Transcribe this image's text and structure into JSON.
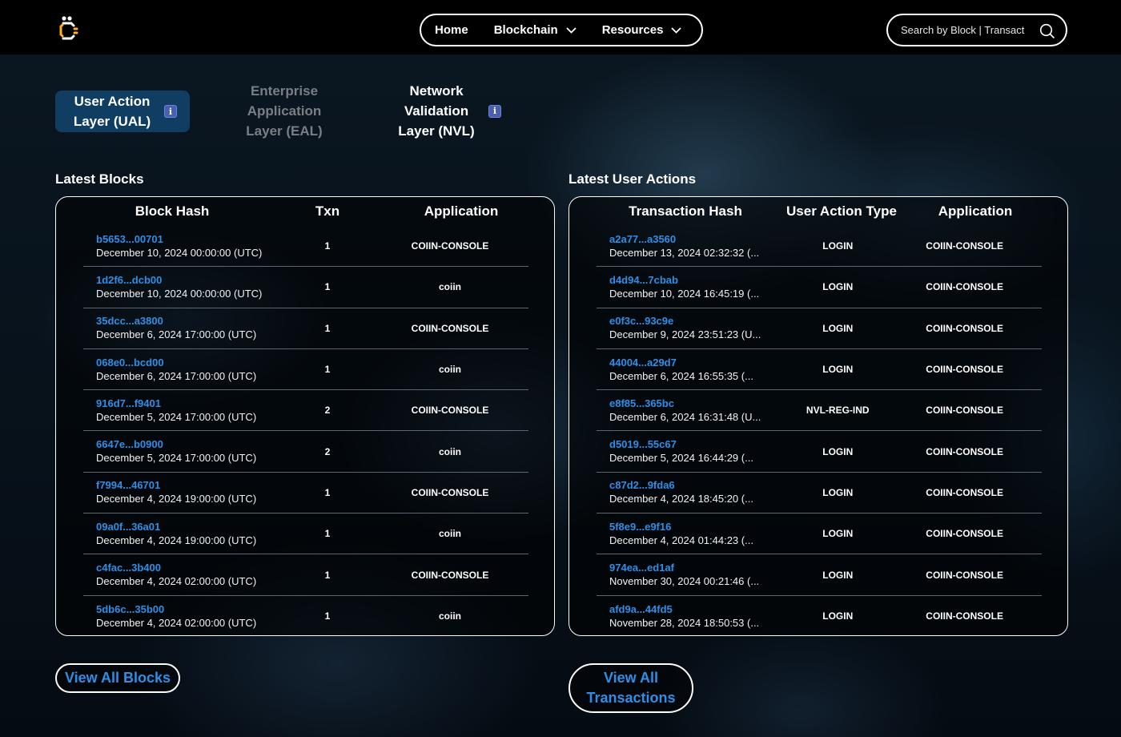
{
  "nav": {
    "home": "Home",
    "blockchain": "Blockchain",
    "resources": "Resources"
  },
  "search": {
    "placeholder": "Search by Block | Transact"
  },
  "layer_tabs": {
    "ual": "User Action Layer (UAL)",
    "eal": "Enterprise Application Layer (EAL)",
    "nvl": "Network Validation Layer (NVL)",
    "info": "i"
  },
  "blocks": {
    "title": "Latest Blocks",
    "headers": [
      "Block Hash",
      "Txn",
      "Application"
    ],
    "rows": [
      {
        "hash": "b5653...00701",
        "date": "December 10, 2024 00:00:00 (UTC)",
        "txn": "1",
        "app": "COIIN-CONSOLE"
      },
      {
        "hash": "1d2f6...dcb00",
        "date": "December 10, 2024 00:00:00 (UTC)",
        "txn": "1",
        "app": "coiin"
      },
      {
        "hash": "35dcc...a3800",
        "date": "December 6, 2024 17:00:00 (UTC)",
        "txn": "1",
        "app": "COIIN-CONSOLE"
      },
      {
        "hash": "068e0...bcd00",
        "date": "December 6, 2024 17:00:00 (UTC)",
        "txn": "1",
        "app": "coiin"
      },
      {
        "hash": "916d7...f9401",
        "date": "December 5, 2024 17:00:00 (UTC)",
        "txn": "2",
        "app": "COIIN-CONSOLE"
      },
      {
        "hash": "6647e...b0900",
        "date": "December 5, 2024 17:00:00 (UTC)",
        "txn": "2",
        "app": "coiin"
      },
      {
        "hash": "f7994...46701",
        "date": "December 4, 2024 19:00:00 (UTC)",
        "txn": "1",
        "app": "COIIN-CONSOLE"
      },
      {
        "hash": "09a0f...36a01",
        "date": "December 4, 2024 19:00:00 (UTC)",
        "txn": "1",
        "app": "coiin"
      },
      {
        "hash": "c4fac...3b400",
        "date": "December 4, 2024 02:00:00 (UTC)",
        "txn": "1",
        "app": "COIIN-CONSOLE"
      },
      {
        "hash": "5db6c...35b00",
        "date": "December 4, 2024 02:00:00 (UTC)",
        "txn": "1",
        "app": "coiin"
      }
    ],
    "view_all": "View All Blocks"
  },
  "actions": {
    "title": "Latest User Actions",
    "headers": [
      "Transaction Hash",
      "User Action Type",
      "Application"
    ],
    "rows": [
      {
        "hash": "a2a77...a3560",
        "date": "December 13, 2024 02:32:32 (...",
        "type": "LOGIN",
        "app": "COIIN-CONSOLE"
      },
      {
        "hash": "d4d94...7cbab",
        "date": "December 10, 2024 16:45:19 (...",
        "type": "LOGIN",
        "app": "COIIN-CONSOLE"
      },
      {
        "hash": "e0f3c...93c9e",
        "date": "December 9, 2024 23:51:23 (U...",
        "type": "LOGIN",
        "app": "COIIN-CONSOLE"
      },
      {
        "hash": "44004...a29d7",
        "date": "December 6, 2024 16:55:35 (...",
        "type": "LOGIN",
        "app": "COIIN-CONSOLE"
      },
      {
        "hash": "e8f85...365bc",
        "date": "December 6, 2024 16:31:48 (U...",
        "type": "NVL-REG-IND",
        "app": "COIIN-CONSOLE"
      },
      {
        "hash": "d5019...55c67",
        "date": "December 5, 2024 16:44:29 (...",
        "type": "LOGIN",
        "app": "COIIN-CONSOLE"
      },
      {
        "hash": "c87d2...9fda6",
        "date": "December 4, 2024 18:45:20 (...",
        "type": "LOGIN",
        "app": "COIIN-CONSOLE"
      },
      {
        "hash": "5f8e9...e9f16",
        "date": "December 4, 2024 01:44:23 (...",
        "type": "LOGIN",
        "app": "COIIN-CONSOLE"
      },
      {
        "hash": "974ea...ed1af",
        "date": "November 30, 2024 00:21:46 (...",
        "type": "LOGIN",
        "app": "COIIN-CONSOLE"
      },
      {
        "hash": "afd9a...44fd5",
        "date": "November 28, 2024 18:50:53 (...",
        "type": "LOGIN",
        "app": "COIIN-CONSOLE"
      }
    ],
    "view_all": "View All Transactions"
  },
  "colors": {
    "accent": "#2f8fe6",
    "active_tab": "#0f3e62",
    "inactive_tab_text": "#7a7f86"
  },
  "icons": [
    "coiin-logo-icon",
    "chevron-down-icon",
    "search-icon",
    "info-icon"
  ]
}
